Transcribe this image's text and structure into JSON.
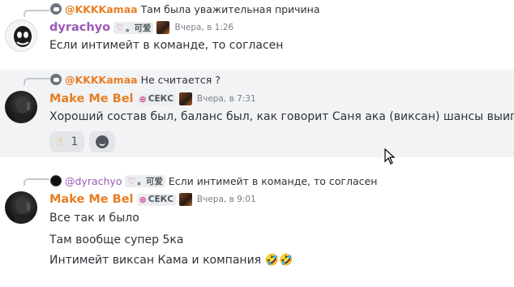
{
  "colors": {
    "orange_name": "#e67e22",
    "purple_name": "#9b59b6",
    "hover_bg": "#f2f3f5"
  },
  "messages": [
    {
      "reply": {
        "mention": "@KKKKamaa",
        "text": "Там была уважительная причина",
        "mention_color": "#e67e22"
      },
      "author": "dyrachyo",
      "author_color": "#9b59b6",
      "tag": {
        "icon": "heart-icon",
        "label": "。可爱"
      },
      "time": "Вчера, в 1:26",
      "lines": [
        "Если интимейт в команде, то согласен"
      ]
    },
    {
      "reply": {
        "mention": "@KKKKamaa",
        "text": "Не считается ?",
        "mention_color": "#e67e22"
      },
      "author": "Make Me Bel",
      "author_color": "#e67e22",
      "tag": {
        "icon": "glasses-icon",
        "label": "СЕКС"
      },
      "time": "Вчера, в 7:31",
      "lines": [
        "Хороший состав был, баланс был, как говорит Саня ака (виксан) шансы выигра"
      ],
      "reactions": [
        {
          "emoji": "☝",
          "count": "1"
        }
      ]
    },
    {
      "reply": {
        "mention": "@dyrachyo",
        "tag_label": "。可爱",
        "text": "Если интимейт в команде, то согласен",
        "mention_color": "#9b59b6"
      },
      "author": "Make Me Bel",
      "author_color": "#e67e22",
      "tag": {
        "icon": "glasses-icon",
        "label": "СЕКС"
      },
      "time": "Вчера, в 9:01",
      "lines": [
        "Все так и было",
        "Там вообще супер 5ка",
        "Интимейт виксан Кама и компания 🤣🤣"
      ]
    }
  ]
}
